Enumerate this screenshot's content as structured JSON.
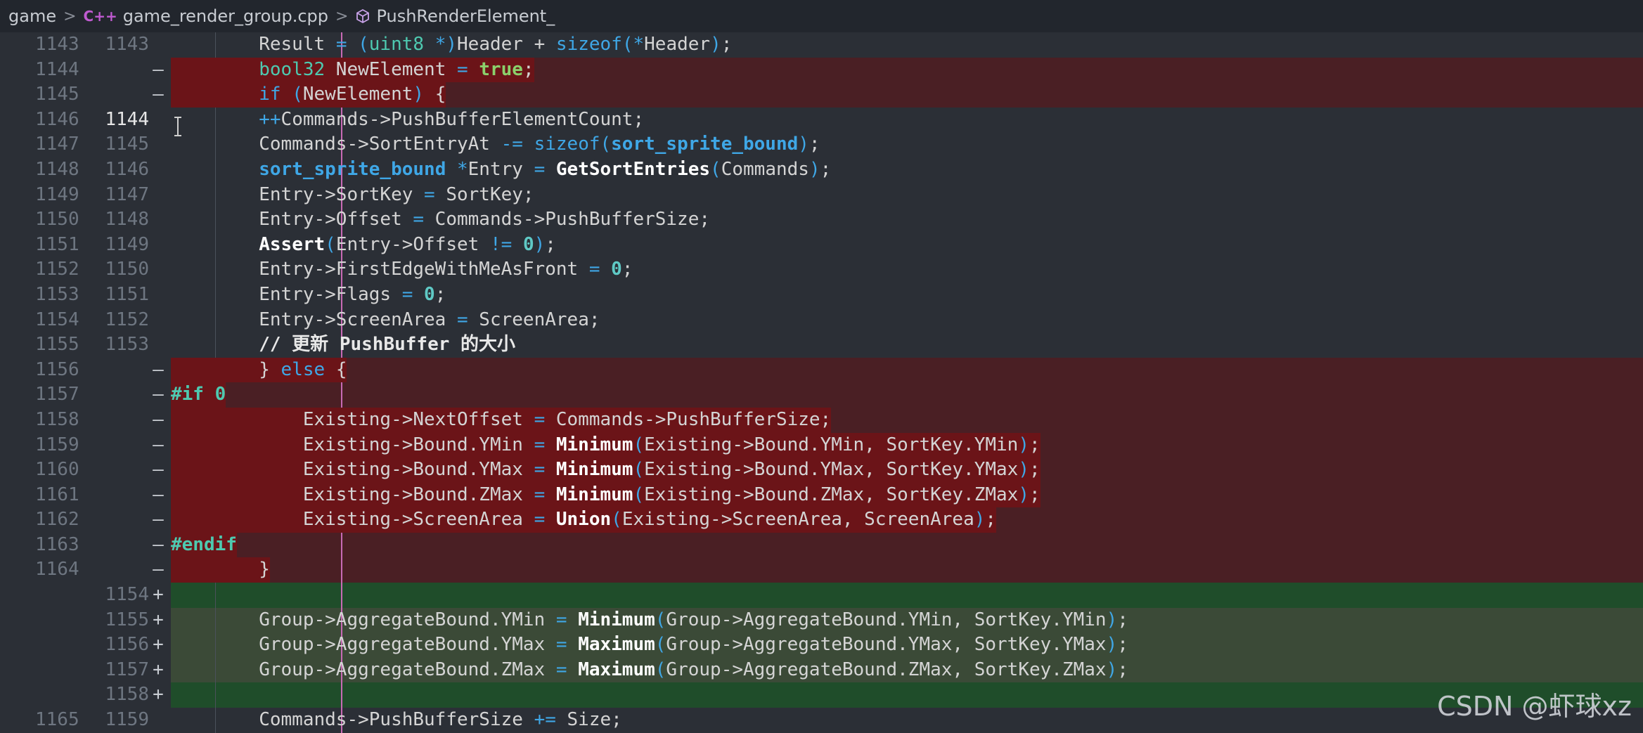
{
  "breadcrumb": {
    "folder": "game",
    "file": "game_render_group.cpp",
    "file_icon": "C++",
    "symbol": "PushRenderElement_"
  },
  "lines": [
    {
      "old": "1143",
      "new": "1143",
      "marker": "",
      "type": "ctx",
      "text": "        Result = (uint8 *)Header + sizeof(*Header);"
    },
    {
      "old": "1144",
      "new": "",
      "marker": "—",
      "type": "del",
      "text": "        bool32 NewElement = true;"
    },
    {
      "old": "1145",
      "new": "",
      "marker": "—",
      "type": "del",
      "text": "        if (NewElement) {"
    },
    {
      "old": "1146",
      "new": "1144",
      "marker": "",
      "type": "ctx",
      "current": true,
      "text": "        ++Commands->PushBufferElementCount;"
    },
    {
      "old": "1147",
      "new": "1145",
      "marker": "",
      "type": "ctx",
      "text": "        Commands->SortEntryAt -= sizeof(sort_sprite_bound);"
    },
    {
      "old": "1148",
      "new": "1146",
      "marker": "",
      "type": "ctx",
      "text": "        sort_sprite_bound *Entry = GetSortEntries(Commands);"
    },
    {
      "old": "1149",
      "new": "1147",
      "marker": "",
      "type": "ctx",
      "text": "        Entry->SortKey = SortKey;"
    },
    {
      "old": "1150",
      "new": "1148",
      "marker": "",
      "type": "ctx",
      "text": "        Entry->Offset = Commands->PushBufferSize;"
    },
    {
      "old": "1151",
      "new": "1149",
      "marker": "",
      "type": "ctx",
      "text": "        Assert(Entry->Offset != 0);"
    },
    {
      "old": "1152",
      "new": "1150",
      "marker": "",
      "type": "ctx",
      "text": "        Entry->FirstEdgeWithMeAsFront = 0;"
    },
    {
      "old": "1153",
      "new": "1151",
      "marker": "",
      "type": "ctx",
      "text": "        Entry->Flags = 0;"
    },
    {
      "old": "1154",
      "new": "1152",
      "marker": "",
      "type": "ctx",
      "text": "        Entry->ScreenArea = ScreenArea;"
    },
    {
      "old": "1155",
      "new": "1153",
      "marker": "",
      "type": "ctx",
      "text": "        // 更新 PushBuffer 的大小"
    },
    {
      "old": "1156",
      "new": "",
      "marker": "—",
      "type": "del",
      "text": "        } else {"
    },
    {
      "old": "1157",
      "new": "",
      "marker": "—",
      "type": "del",
      "text": "#if 0"
    },
    {
      "old": "1158",
      "new": "",
      "marker": "—",
      "type": "del",
      "text": "            Existing->NextOffset = Commands->PushBufferSize;"
    },
    {
      "old": "1159",
      "new": "",
      "marker": "—",
      "type": "del",
      "text": "            Existing->Bound.YMin = Minimum(Existing->Bound.YMin, SortKey.YMin);"
    },
    {
      "old": "1160",
      "new": "",
      "marker": "—",
      "type": "del",
      "text": "            Existing->Bound.YMax = Minimum(Existing->Bound.YMax, SortKey.YMax);"
    },
    {
      "old": "1161",
      "new": "",
      "marker": "—",
      "type": "del",
      "text": "            Existing->Bound.ZMax = Minimum(Existing->Bound.ZMax, SortKey.ZMax);"
    },
    {
      "old": "1162",
      "new": "",
      "marker": "—",
      "type": "del",
      "text": "            Existing->ScreenArea = Union(Existing->ScreenArea, ScreenArea);"
    },
    {
      "old": "1163",
      "new": "",
      "marker": "—",
      "type": "del",
      "text": "#endif"
    },
    {
      "old": "1164",
      "new": "",
      "marker": "—",
      "type": "del",
      "text": "        }"
    },
    {
      "old": "",
      "new": "1154",
      "marker": "+",
      "type": "add",
      "empty": true,
      "text": ""
    },
    {
      "old": "",
      "new": "1155",
      "marker": "+",
      "type": "add",
      "text": "        Group->AggregateBound.YMin = Minimum(Group->AggregateBound.YMin, SortKey.YMin);"
    },
    {
      "old": "",
      "new": "1156",
      "marker": "+",
      "type": "add",
      "text": "        Group->AggregateBound.YMax = Maximum(Group->AggregateBound.YMax, SortKey.YMax);"
    },
    {
      "old": "",
      "new": "1157",
      "marker": "+",
      "type": "add",
      "text": "        Group->AggregateBound.ZMax = Maximum(Group->AggregateBound.ZMax, SortKey.ZMax);"
    },
    {
      "old": "",
      "new": "1158",
      "marker": "+",
      "type": "add",
      "empty": true,
      "text": ""
    },
    {
      "old": "1165",
      "new": "1159",
      "marker": "",
      "type": "ctx",
      "text": "        Commands->PushBufferSize += Size;"
    }
  ],
  "watermark": "CSDN @虾球xz",
  "colors": {
    "deleted_line": "#4a1f24",
    "added_line": "#3b4a37",
    "change_bar": "#c86ab5"
  }
}
